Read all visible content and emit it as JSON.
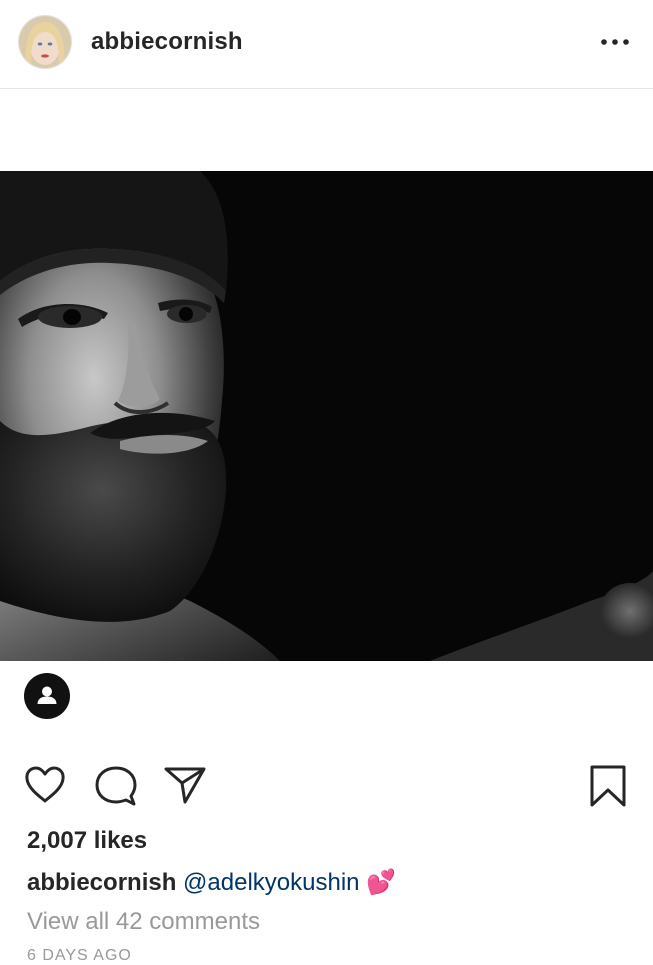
{
  "post": {
    "username": "abbiecornish",
    "likes": "2,007 likes",
    "caption": {
      "username": "abbiecornish",
      "mention": "@adelkyokushin",
      "emoji": "💕"
    },
    "view_all_comments": "View all 42 comments",
    "timestamp": "6 DAYS AGO"
  },
  "icons": {
    "more": "more-options-icon",
    "tag": "person-tag-icon",
    "like": "heart-icon",
    "comment": "comment-icon",
    "share": "share-direct-icon",
    "save": "bookmark-icon"
  },
  "colors": {
    "text": "#262626",
    "mention": "#003569",
    "muted": "#999999",
    "divider": "#e6e6e6"
  }
}
